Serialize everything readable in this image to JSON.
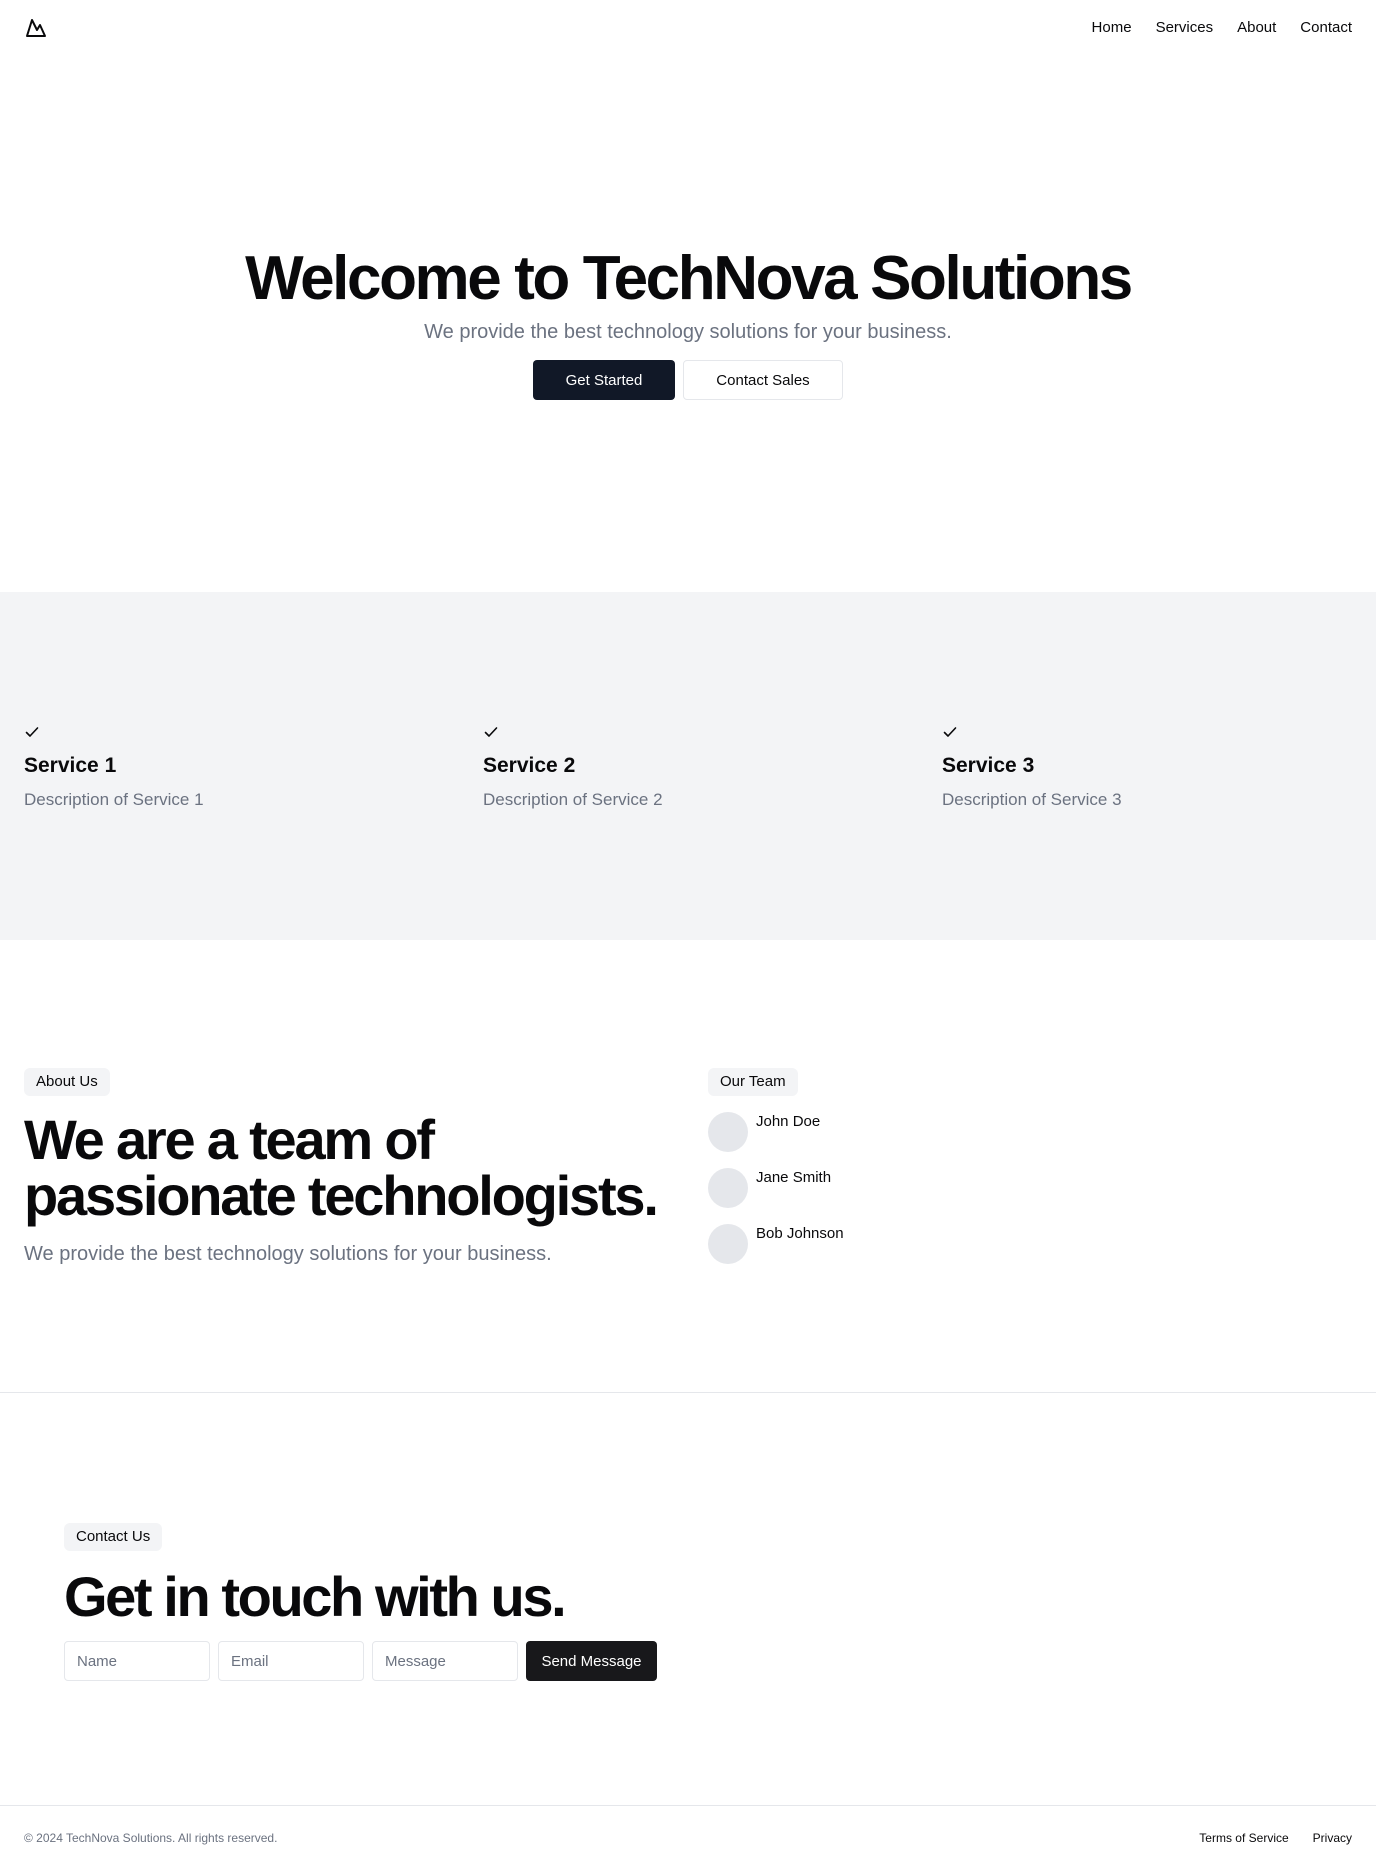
{
  "header": {
    "logo_icon": "mountain-icon",
    "nav": [
      "Home",
      "Services",
      "About",
      "Contact"
    ]
  },
  "hero": {
    "title": "Welcome to TechNova Solutions",
    "subtitle": "We provide the best technology solutions for your business.",
    "primary_button": "Get Started",
    "secondary_button": "Contact Sales"
  },
  "services": {
    "icon": "check-icon",
    "items": [
      {
        "title": "Service 1",
        "description": "Description of Service 1"
      },
      {
        "title": "Service 2",
        "description": "Description of Service 2"
      },
      {
        "title": "Service 3",
        "description": "Description of Service 3"
      }
    ]
  },
  "about": {
    "badge": "About Us",
    "title_line1": "We are a team of",
    "title_line2": "passionate technologists.",
    "subtitle": "We provide the best technology solutions for your business.",
    "team_badge": "Our Team",
    "team": [
      "John Doe",
      "Jane Smith",
      "Bob Johnson"
    ]
  },
  "contact": {
    "badge": "Contact Us",
    "title": "Get in touch with us.",
    "name_placeholder": "Name",
    "email_placeholder": "Email",
    "message_placeholder": "Message",
    "submit_label": "Send Message"
  },
  "footer": {
    "copyright": "© 2024 TechNova Solutions. All rights reserved.",
    "links": [
      "Terms of Service",
      "Privacy"
    ]
  },
  "colors": {
    "primary": "#111827",
    "muted_text": "#6b7280",
    "section_bg": "#f3f4f6",
    "border": "#e5e7eb"
  }
}
